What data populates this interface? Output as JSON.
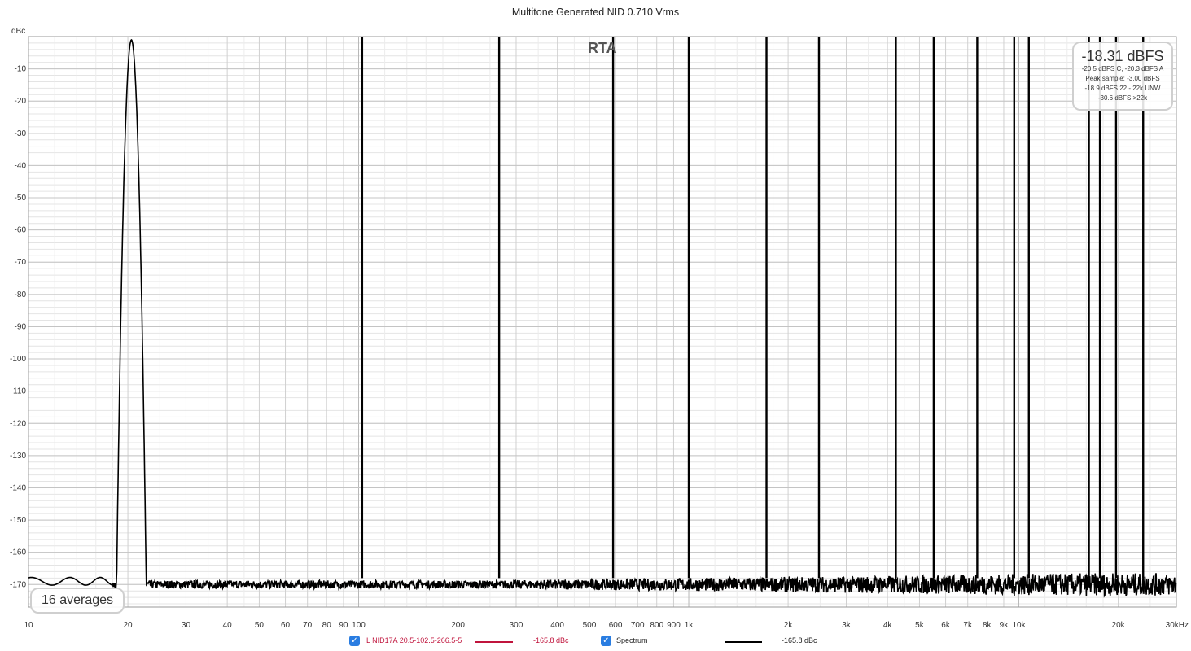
{
  "title": "Multitone Generated NID 0.710 Vrms",
  "overlay_label": "RTA",
  "info_box": {
    "main": "-18.31 dBFS",
    "lines": [
      "-20.5 dBFS C, -20.3 dBFS A",
      "Peak sample: -3.00 dBFS",
      "-18.9 dBFS 22 - 22k UNW",
      "-30.6 dBFS >22k"
    ]
  },
  "averages_label": "16 averages",
  "legend": [
    {
      "checked": true,
      "name": "L NID17A 20.5-102.5-266.5-5",
      "value": "-165.8 dBc",
      "color": "#c0143c"
    },
    {
      "checked": true,
      "name": "Spectrum",
      "value": "-165.8 dBc",
      "color": "#000000"
    }
  ],
  "chart_data": {
    "type": "line",
    "title": "Multitone Generated NID 0.710 Vrms",
    "ylabel": "dBc",
    "xlabel": "",
    "x_scale": "log",
    "xlim": [
      10,
      30000
    ],
    "ylim": [
      -177,
      0
    ],
    "y_ticks": [
      -10,
      -20,
      -30,
      -40,
      -50,
      -60,
      -70,
      -80,
      -90,
      -100,
      -110,
      -120,
      -130,
      -140,
      -150,
      -160,
      -170
    ],
    "x_ticks": [
      {
        "v": 10,
        "label": "10"
      },
      {
        "v": 20,
        "label": "20"
      },
      {
        "v": 30,
        "label": "30"
      },
      {
        "v": 40,
        "label": "40"
      },
      {
        "v": 50,
        "label": "50"
      },
      {
        "v": 60,
        "label": "60"
      },
      {
        "v": 70,
        "label": "70"
      },
      {
        "v": 80,
        "label": "80"
      },
      {
        "v": 90,
        "label": "90"
      },
      {
        "v": 100,
        "label": "100"
      },
      {
        "v": 200,
        "label": "200"
      },
      {
        "v": 300,
        "label": "300"
      },
      {
        "v": 400,
        "label": "400"
      },
      {
        "v": 500,
        "label": "500"
      },
      {
        "v": 600,
        "label": "600"
      },
      {
        "v": 700,
        "label": "700"
      },
      {
        "v": 800,
        "label": "800"
      },
      {
        "v": 900,
        "label": "900"
      },
      {
        "v": 1000,
        "label": "1k"
      },
      {
        "v": 2000,
        "label": "2k"
      },
      {
        "v": 3000,
        "label": "3k"
      },
      {
        "v": 4000,
        "label": "4k"
      },
      {
        "v": 5000,
        "label": "5k"
      },
      {
        "v": 6000,
        "label": "6k"
      },
      {
        "v": 7000,
        "label": "7k"
      },
      {
        "v": 8000,
        "label": "8k"
      },
      {
        "v": 9000,
        "label": "9k"
      },
      {
        "v": 10000,
        "label": "10k"
      },
      {
        "v": 20000,
        "label": "20k"
      },
      {
        "v": 30000,
        "label": "30kHz"
      }
    ],
    "tones_hz": [
      20.5,
      102.5,
      266.5,
      590,
      1000,
      1720,
      2480,
      4240,
      5520,
      7480,
      9680,
      10720,
      16300,
      17600,
      19700,
      23800
    ],
    "tone_level_dbc": 0,
    "noise_floor_dbc": -170,
    "series": [
      {
        "name": "L NID17A 20.5-102.5-266.5-5",
        "color": "#c0143c"
      },
      {
        "name": "Spectrum",
        "color": "#000000"
      }
    ],
    "grid": true
  }
}
